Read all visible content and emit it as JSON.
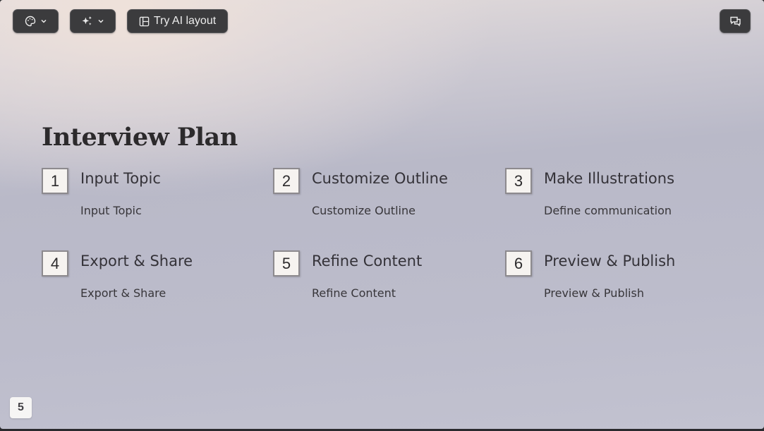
{
  "toolbar": {
    "theme_icon": "palette-icon",
    "ai_icon": "sparkles-icon",
    "layout_icon": "layout-icon",
    "layout_label": "Try AI layout",
    "comment_icon": "comment-icon"
  },
  "slide": {
    "title": "Interview Plan",
    "steps": [
      {
        "number": "1",
        "title": "Input Topic",
        "description": "Input Topic"
      },
      {
        "number": "2",
        "title": "Customize Outline",
        "description": "Customize Outline"
      },
      {
        "number": "3",
        "title": "Make Illustrations",
        "description": "Define communication"
      },
      {
        "number": "4",
        "title": "Export & Share",
        "description": "Export & Share"
      },
      {
        "number": "5",
        "title": "Refine Content",
        "description": "Refine Content"
      },
      {
        "number": "6",
        "title": "Preview & Publish",
        "description": "Preview & Publish"
      }
    ]
  },
  "page_number": "5"
}
